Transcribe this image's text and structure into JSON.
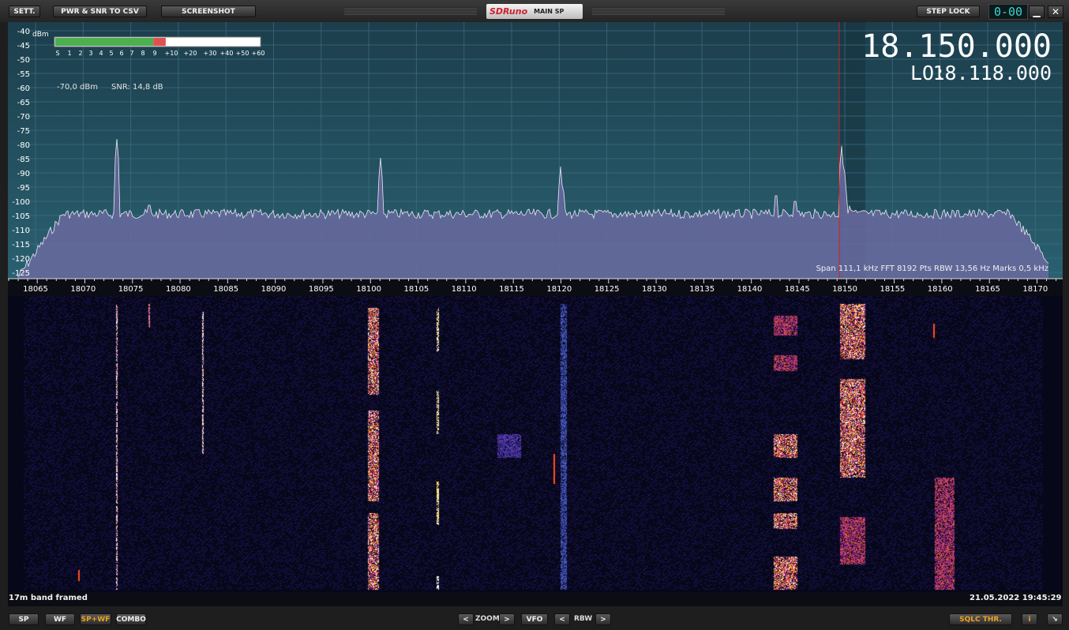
{
  "toolbar": {
    "settings_label": "SETT.",
    "csv_label": "PWR & SNR TO CSV",
    "screenshot_label": "SCREENSHOT",
    "brand": "SDRuno",
    "window_title": "MAIN SP",
    "step_lock_label": "STEP LOCK",
    "lcd_value": "0-00"
  },
  "spectrum": {
    "freq_display": "18.150.000",
    "lo_label": "LO:",
    "lo_value": "18.118.000",
    "dbm_unit": "dBm",
    "signal_readout": "-70,0 dBm",
    "snr_readout": "SNR: 14,8 dB",
    "smeter_scale": [
      "S",
      "1",
      "2",
      "3",
      "4",
      "5",
      "6",
      "7",
      "8",
      "9",
      "+10",
      "+20",
      "+30",
      "+40",
      "+50",
      "+60"
    ],
    "smeter_level": 0.54,
    "y_ticks": [
      "-40",
      "-45",
      "-50",
      "-55",
      "-60",
      "-65",
      "-70",
      "-75",
      "-80",
      "-85",
      "-90",
      "-95",
      "-100",
      "-105",
      "-110",
      "-115",
      "-120",
      "-125"
    ],
    "x_ticks": [
      "18065",
      "18070",
      "18075",
      "18080",
      "18085",
      "18090",
      "18095",
      "18100",
      "18105",
      "18110",
      "18115",
      "18120",
      "18125",
      "18130",
      "18135",
      "18140",
      "18145",
      "18150",
      "18155",
      "18160",
      "18165",
      "18170"
    ],
    "info_line": "Span 111,1 kHz  FFT 8192 Pts  RBW 13,56 Hz  Marks 0,5 kHz",
    "colors": {
      "plot_bg": "#1d4650",
      "fill": "#6a6aa0",
      "trace": "#e8e8f0",
      "cursor": "#d02020",
      "smeter_green": "#4caf50",
      "smeter_red": "#e05050"
    }
  },
  "status": {
    "left": "17m band framed",
    "right": "21.05.2022 19:45:29"
  },
  "bottombar": {
    "sp": "SP",
    "wf": "WF",
    "spwf": "SP+WF",
    "combo": "COMBO",
    "prev": "<",
    "zoom": "ZOOM",
    "next": ">",
    "vfo": "VFO",
    "rbw_prev": "<",
    "rbw": "RBW",
    "rbw_next": ">",
    "sqlc": "SQLC THR.",
    "info": "i",
    "resize": "↘"
  }
}
